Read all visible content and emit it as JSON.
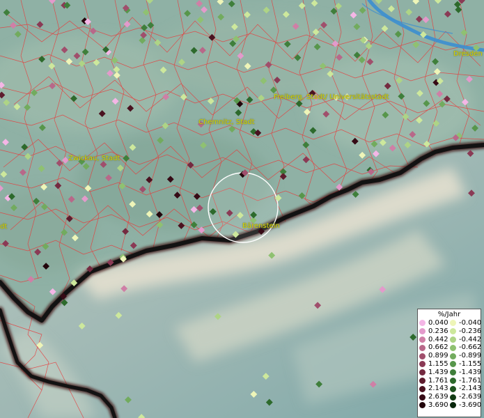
{
  "legend": {
    "title": "%/Jahr",
    "positive": [
      {
        "value": "0.040",
        "color": "#f4b6e6"
      },
      {
        "value": "0.236",
        "color": "#e39acb"
      },
      {
        "value": "0.442",
        "color": "#cf7fa6"
      },
      {
        "value": "0.662",
        "color": "#b86889"
      },
      {
        "value": "0.899",
        "color": "#a04f6c"
      },
      {
        "value": "1.155",
        "color": "#8a3a55"
      },
      {
        "value": "1.439",
        "color": "#742a40"
      },
      {
        "value": "1.761",
        "color": "#5e1c2e"
      },
      {
        "value": "2.143",
        "color": "#4a1220"
      },
      {
        "value": "2.639",
        "color": "#360a15"
      },
      {
        "value": "3.690",
        "color": "#22050b"
      }
    ],
    "negative": [
      {
        "value": "-0.040",
        "color": "#eef5b8"
      },
      {
        "value": "-0.236",
        "color": "#cde89c"
      },
      {
        "value": "-0.442",
        "color": "#aed486"
      },
      {
        "value": "-0.662",
        "color": "#8fc171"
      },
      {
        "value": "-0.899",
        "color": "#72ab5e"
      },
      {
        "value": "-1.155",
        "color": "#57964b"
      },
      {
        "value": "-1.439",
        "color": "#3f7f3b"
      },
      {
        "value": "-1.761",
        "color": "#2d6a2c"
      },
      {
        "value": "-2.143",
        "color": "#1e531f"
      },
      {
        "value": "-2.639",
        "color": "#123c14"
      },
      {
        "value": "-3.690",
        "color": "#06250a"
      }
    ]
  },
  "places": [
    {
      "name": "Dresden"
    },
    {
      "name": "Freiberg, Stadt/ Universitätsstadt"
    },
    {
      "name": "Chemnitz, Stadt"
    },
    {
      "name": "Zwickau, Stadt"
    },
    {
      "name": "Bärenstein"
    },
    {
      "name": "dt"
    }
  ],
  "colors": {
    "boundary_lines": "#e83a3a",
    "national_border": "#1a1a1a",
    "river": "#3c8fd0",
    "label": "#d8d400",
    "highlight_circle": "#ffffff"
  }
}
